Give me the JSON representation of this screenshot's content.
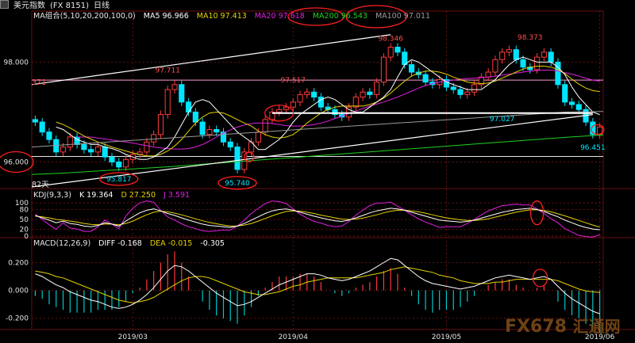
{
  "header": {
    "title": "美元指数",
    "code": "(FX 8151)",
    "period": "日线"
  },
  "colors": {
    "background": "#000000",
    "grid": "#6a1010",
    "up": "#ff3b3b",
    "down": "#00e5ff",
    "ma5": "#ffffff",
    "ma10": "#e5d200",
    "ma20": "#e020e0",
    "ma100": "#9a9a9a",
    "ma200": "#1fd11f",
    "annotation": "#ff2020",
    "label_high": "#ff5050",
    "label_low": "#00e5ff"
  },
  "main_legend": {
    "group": "MA组合(5,10,20,200,100,0)",
    "ma5": "MA5 96.966",
    "ma10": "MA10 97.413",
    "ma20": "MA20 97.618",
    "ma200": "MA200 96.543",
    "ma100": "MA100 97.011"
  },
  "kdj_legend": {
    "name": "KDJ(9,3,3)",
    "k": "K 19.364",
    "d": "D 27.250",
    "j": "J 3.591"
  },
  "macd_legend": {
    "name": "MACD(12,26,9)",
    "diff": "DIFF -0.168",
    "dea": "DEA -0.015",
    "macd": "-0.305"
  },
  "side_labels": {
    "cut_top": "371",
    "days": "82天"
  },
  "watermark": {
    "brand": "FX678",
    "cn": "汇通网"
  },
  "chart_data": [
    {
      "type": "candlestick",
      "name": "main",
      "ylim": [
        95.5,
        98.8
      ],
      "yticks": [
        96.0,
        98.0
      ],
      "ytick_labels": [
        "96.000",
        "98.000"
      ],
      "x_count": 82,
      "x_tick_labels": [
        {
          "i": 14,
          "label": "2019/03"
        },
        {
          "i": 37,
          "label": "2019/04"
        },
        {
          "i": 59,
          "label": "2019/05"
        },
        {
          "i": 81,
          "label": "2019/06"
        }
      ],
      "close": [
        96.8,
        96.6,
        96.45,
        96.2,
        96.3,
        96.5,
        96.35,
        96.25,
        96.2,
        96.3,
        96.1,
        96.0,
        95.9,
        96.05,
        96.15,
        96.2,
        96.4,
        96.55,
        96.95,
        97.45,
        97.55,
        97.2,
        97.0,
        96.8,
        96.55,
        96.65,
        96.6,
        96.4,
        96.3,
        95.85,
        96.2,
        96.4,
        96.6,
        96.85,
        97.0,
        97.05,
        97.1,
        97.2,
        97.35,
        97.4,
        97.3,
        97.1,
        97.05,
        96.95,
        96.9,
        97.1,
        97.3,
        97.4,
        97.35,
        97.6,
        98.1,
        98.3,
        98.2,
        97.95,
        97.8,
        97.75,
        97.6,
        97.55,
        97.65,
        97.5,
        97.45,
        97.35,
        97.4,
        97.55,
        97.7,
        97.8,
        98.05,
        98.2,
        98.25,
        98.05,
        97.9,
        97.85,
        98.1,
        98.2,
        98.0,
        97.55,
        97.2,
        97.15,
        97.05,
        96.8,
        96.55,
        96.7
      ],
      "ma5": [
        96.7,
        96.65,
        96.55,
        96.45,
        96.4,
        96.35,
        96.35,
        96.3,
        96.27,
        96.22,
        96.15,
        96.1,
        96.05,
        96.05,
        96.1,
        96.2,
        96.3,
        96.5,
        96.75,
        97.0,
        97.2,
        97.25,
        97.2,
        97.05,
        96.9,
        96.75,
        96.6,
        96.5,
        96.4,
        96.25,
        96.25,
        96.35,
        96.45,
        96.6,
        96.8,
        96.95,
        97.05,
        97.15,
        97.25,
        97.3,
        97.25,
        97.15,
        97.05,
        97.0,
        97.0,
        97.1,
        97.2,
        97.3,
        97.45,
        97.7,
        97.95,
        98.05,
        98.0,
        97.9,
        97.8,
        97.7,
        97.6,
        97.55,
        97.5,
        97.45,
        97.45,
        97.45,
        97.55,
        97.65,
        97.8,
        97.95,
        98.05,
        98.1,
        98.05,
        98.0,
        98.0,
        98.0,
        97.9,
        97.75,
        97.5,
        97.3,
        97.15,
        97.0,
        96.95
      ],
      "ma10": [
        96.8,
        96.75,
        96.68,
        96.6,
        96.52,
        96.46,
        96.4,
        96.35,
        96.3,
        96.26,
        96.22,
        96.18,
        96.15,
        96.12,
        96.12,
        96.15,
        96.22,
        96.32,
        96.45,
        96.62,
        96.78,
        96.9,
        96.98,
        97.0,
        96.98,
        96.92,
        96.85,
        96.78,
        96.72,
        96.62,
        96.55,
        96.5,
        96.48,
        96.5,
        96.55,
        96.65,
        96.78,
        96.88,
        96.98,
        97.05,
        97.1,
        97.12,
        97.12,
        97.12,
        97.12,
        97.15,
        97.2,
        97.28,
        97.38,
        97.5,
        97.62,
        97.72,
        97.78,
        97.82,
        97.82,
        97.8,
        97.76,
        97.7,
        97.65,
        97.6,
        97.58,
        97.57,
        97.58,
        97.62,
        97.68,
        97.74,
        97.8,
        97.86,
        97.9,
        97.92,
        97.92,
        97.9,
        97.85,
        97.77,
        97.66,
        97.56,
        97.48,
        97.43,
        97.41
      ],
      "ma20": [
        96.5,
        96.5,
        96.5,
        96.48,
        96.46,
        96.44,
        96.42,
        96.4,
        96.38,
        96.35,
        96.33,
        96.3,
        96.28,
        96.27,
        96.26,
        96.26,
        96.27,
        96.3,
        96.35,
        96.42,
        96.5,
        96.58,
        96.64,
        96.7,
        96.74,
        96.77,
        96.78,
        96.78,
        96.77,
        96.75,
        96.73,
        96.72,
        96.72,
        96.73,
        96.75,
        96.78,
        96.82,
        96.87,
        96.92,
        96.97,
        97.02,
        97.07,
        97.12,
        97.16,
        97.2,
        97.25,
        97.3,
        97.36,
        97.42,
        97.48,
        97.53,
        97.57,
        97.6,
        97.62,
        97.64,
        97.66,
        97.67,
        97.68,
        97.69,
        97.7,
        97.72,
        97.74,
        97.76,
        97.78,
        97.8,
        97.82,
        97.83,
        97.84,
        97.84,
        97.82,
        97.79,
        97.76,
        97.72,
        97.68,
        97.64,
        97.62
      ],
      "ma100": [
        96.3,
        96.35,
        96.4,
        96.45,
        96.5,
        96.55,
        96.6,
        96.65,
        96.7,
        96.75,
        96.8,
        96.85,
        96.9,
        96.95,
        97.0,
        97.01
      ],
      "ma200": [
        95.75,
        95.78,
        95.82,
        95.86,
        95.9,
        95.95,
        96.0,
        96.05,
        96.1,
        96.15,
        96.2,
        96.25,
        96.3,
        96.35,
        96.4,
        96.45,
        96.5,
        96.54
      ],
      "annotations": [
        {
          "i": 19,
          "value": 97.711,
          "text": "97.711",
          "kind": "high"
        },
        {
          "i": 12,
          "value": 95.817,
          "text": "95.817",
          "kind": "low",
          "circled": true
        },
        {
          "i": 29,
          "value": 95.74,
          "text": "95.740",
          "kind": "low",
          "circled": true
        },
        {
          "i": 37,
          "value": 97.517,
          "text": "97.517",
          "kind": "high"
        },
        {
          "i": 51,
          "value": 98.346,
          "text": "98.346",
          "kind": "high"
        },
        {
          "i": 67,
          "value": 97.027,
          "text": "97.027",
          "kind": "low"
        },
        {
          "i": 71,
          "value": 98.373,
          "text": "98.373",
          "kind": "high"
        },
        {
          "i": 80,
          "value": 96.451,
          "text": "96.451",
          "kind": "low"
        }
      ]
    },
    {
      "type": "line",
      "name": "KDJ(9,3,3)",
      "ylim": [
        -5,
        110
      ],
      "yticks": [
        0,
        20,
        50,
        80,
        100
      ],
      "k": [
        62,
        55,
        48,
        40,
        45,
        38,
        35,
        30,
        28,
        32,
        40,
        36,
        30,
        45,
        58,
        70,
        78,
        82,
        76,
        68,
        62,
        55,
        48,
        42,
        36,
        32,
        30,
        28,
        26,
        30,
        38,
        48,
        58,
        68,
        76,
        80,
        82,
        78,
        72,
        66,
        60,
        55,
        50,
        46,
        44,
        48,
        55,
        62,
        70,
        76,
        80,
        84,
        82,
        78,
        72,
        66,
        60,
        54,
        48,
        46,
        44,
        42,
        44,
        48,
        54,
        60,
        66,
        72,
        76,
        80,
        82,
        84,
        80,
        74,
        66,
        58,
        48,
        40,
        32,
        26,
        21,
        19
      ],
      "d": [
        60,
        58,
        55,
        50,
        48,
        45,
        42,
        38,
        35,
        34,
        36,
        36,
        34,
        38,
        45,
        55,
        64,
        72,
        75,
        73,
        69,
        64,
        58,
        52,
        46,
        41,
        37,
        33,
        30,
        30,
        33,
        38,
        45,
        53,
        61,
        68,
        74,
        76,
        75,
        72,
        68,
        63,
        59,
        55,
        51,
        50,
        51,
        54,
        59,
        64,
        70,
        75,
        78,
        78,
        76,
        73,
        69,
        64,
        59,
        55,
        52,
        49,
        47,
        47,
        49,
        52,
        57,
        62,
        67,
        72,
        76,
        79,
        79,
        77,
        73,
        67,
        61,
        54,
        47,
        40,
        33,
        27
      ],
      "j": [
        66,
        50,
        34,
        20,
        40,
        24,
        21,
        14,
        14,
        28,
        48,
        36,
        22,
        60,
        84,
        100,
        106,
        102,
        78,
        58,
        48,
        37,
        28,
        22,
        16,
        14,
        16,
        18,
        18,
        30,
        48,
        68,
        84,
        98,
        106,
        104,
        98,
        82,
        66,
        54,
        44,
        39,
        32,
        28,
        30,
        44,
        63,
        78,
        92,
        100,
        100,
        102,
        90,
        78,
        64,
        52,
        42,
        34,
        26,
        28,
        28,
        28,
        38,
        50,
        64,
        76,
        84,
        92,
        94,
        96,
        94,
        94,
        82,
        68,
        52,
        40,
        22,
        12,
        2,
        -2,
        -3,
        3.6
      ]
    },
    {
      "type": "bar+line",
      "name": "MACD(12,26,9)",
      "ylim": [
        -0.27,
        0.3
      ],
      "yticks": [
        0.2,
        0.0,
        -0.2
      ],
      "ytick_labels": [
        "0.200",
        "0.000",
        "-0.200"
      ],
      "diff": [
        0.12,
        0.1,
        0.07,
        0.04,
        0.02,
        -0.01,
        -0.03,
        -0.05,
        -0.07,
        -0.08,
        -0.1,
        -0.12,
        -0.13,
        -0.12,
        -0.1,
        -0.07,
        -0.03,
        0.02,
        0.08,
        0.14,
        0.18,
        0.17,
        0.14,
        0.1,
        0.06,
        0.02,
        -0.02,
        -0.05,
        -0.08,
        -0.11,
        -0.1,
        -0.08,
        -0.05,
        -0.02,
        0.01,
        0.04,
        0.06,
        0.08,
        0.1,
        0.12,
        0.12,
        0.11,
        0.09,
        0.08,
        0.07,
        0.08,
        0.1,
        0.12,
        0.14,
        0.17,
        0.2,
        0.23,
        0.22,
        0.18,
        0.14,
        0.1,
        0.07,
        0.05,
        0.04,
        0.03,
        0.02,
        0.01,
        0.02,
        0.03,
        0.05,
        0.07,
        0.09,
        0.1,
        0.11,
        0.1,
        0.09,
        0.08,
        0.09,
        0.1,
        0.08,
        0.03,
        -0.02,
        -0.06,
        -0.09,
        -0.12,
        -0.15,
        -0.168
      ],
      "dea": [
        0.14,
        0.13,
        0.12,
        0.1,
        0.09,
        0.07,
        0.05,
        0.03,
        0.01,
        -0.01,
        -0.03,
        -0.05,
        -0.07,
        -0.08,
        -0.09,
        -0.08,
        -0.07,
        -0.05,
        -0.02,
        0.01,
        0.04,
        0.07,
        0.09,
        0.1,
        0.1,
        0.09,
        0.07,
        0.05,
        0.03,
        0.01,
        -0.01,
        -0.02,
        -0.03,
        -0.03,
        -0.02,
        -0.01,
        0.01,
        0.03,
        0.04,
        0.06,
        0.07,
        0.08,
        0.09,
        0.09,
        0.09,
        0.09,
        0.09,
        0.1,
        0.11,
        0.12,
        0.13,
        0.15,
        0.16,
        0.17,
        0.16,
        0.15,
        0.14,
        0.13,
        0.11,
        0.1,
        0.09,
        0.07,
        0.06,
        0.05,
        0.05,
        0.05,
        0.06,
        0.06,
        0.07,
        0.08,
        0.08,
        0.08,
        0.08,
        0.08,
        0.08,
        0.07,
        0.05,
        0.03,
        0.01,
        -0.003,
        -0.01,
        -0.015
      ],
      "macd": [
        -0.04,
        -0.06,
        -0.1,
        -0.12,
        -0.14,
        -0.16,
        -0.16,
        -0.16,
        -0.16,
        -0.14,
        -0.14,
        -0.14,
        -0.12,
        -0.08,
        -0.02,
        0.02,
        0.08,
        0.14,
        0.2,
        0.26,
        0.28,
        0.2,
        0.1,
        0.0,
        -0.08,
        -0.14,
        -0.18,
        -0.2,
        -0.22,
        -0.24,
        -0.18,
        -0.12,
        -0.04,
        0.02,
        0.06,
        0.1,
        0.1,
        0.1,
        0.12,
        0.12,
        0.1,
        0.06,
        0.0,
        -0.02,
        -0.04,
        -0.02,
        0.02,
        0.04,
        0.06,
        0.1,
        0.14,
        0.16,
        0.12,
        0.02,
        -0.04,
        -0.1,
        -0.14,
        -0.16,
        -0.14,
        -0.14,
        -0.14,
        -0.12,
        -0.08,
        -0.04,
        0.0,
        0.04,
        0.06,
        0.08,
        0.08,
        0.04,
        0.02,
        0.0,
        0.02,
        0.04,
        0.0,
        -0.08,
        -0.14,
        -0.18,
        -0.2,
        -0.24,
        -0.28,
        -0.305
      ]
    }
  ]
}
